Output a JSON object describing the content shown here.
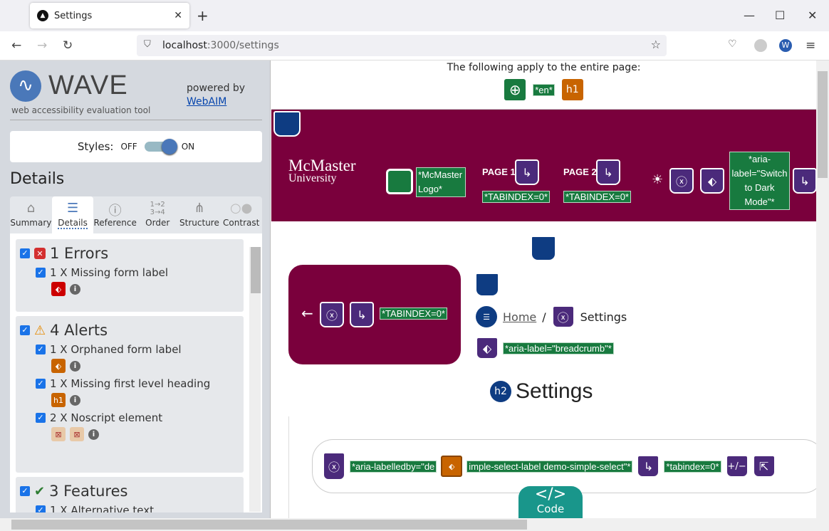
{
  "browser": {
    "tab_title": "Settings",
    "url_host": "localhost",
    "url_path": ":3000/settings"
  },
  "sidebar": {
    "logo_text": "WAVE",
    "subtitle": "web accessibility evaluation tool",
    "powered_by": "powered by",
    "webaim": "WebAIM",
    "styles_label": "Styles:",
    "off": "OFF",
    "on": "ON",
    "styles_on": true,
    "heading": "Details",
    "tabs": [
      {
        "label": "Summary",
        "icon": "home-icon"
      },
      {
        "label": "Details",
        "icon": "list-icon",
        "active": true
      },
      {
        "label": "Reference",
        "icon": "info-icon"
      },
      {
        "label": "Order",
        "icon": "order-icon"
      },
      {
        "label": "Structure",
        "icon": "structure-icon"
      },
      {
        "label": "Contrast",
        "icon": "contrast-icon"
      }
    ],
    "errors": {
      "title": "1 Errors",
      "items": [
        "1 X Missing form label"
      ]
    },
    "alerts": {
      "title": "4 Alerts",
      "items": [
        "1 X Orphaned form label",
        "1 X Missing first level heading",
        "2 X Noscript element"
      ]
    },
    "features": {
      "title": "3 Features",
      "items": [
        "1 X Alternative text"
      ]
    }
  },
  "page": {
    "apply_text": "The following apply to the entire page:",
    "lang": "*en*",
    "h1": "h1",
    "logo_line1": "McMaster",
    "logo_line2": "University",
    "alt_logo": "*McMaster Logo*",
    "page1": "PAGE 1",
    "page2": "PAGE 2",
    "tabindex": "*TABINDEX=0*",
    "aria_dark": "*aria-label=\"Switch to Dark Mode\"*",
    "back_arrow": "←",
    "home": "Home",
    "sep": "/",
    "crumb": "Settings",
    "aria_breadcrumb": "*aria-label=\"breadcrumb\"*",
    "h2": "h2",
    "title": "Settings",
    "labelledby1": "*aria-labelledby=\"de",
    "labelledby2": "imple-select-label demo-simple-select\"*",
    "tabindex_lower": "*tabindex=0*",
    "plusminus": "+/−",
    "code": "Code"
  }
}
